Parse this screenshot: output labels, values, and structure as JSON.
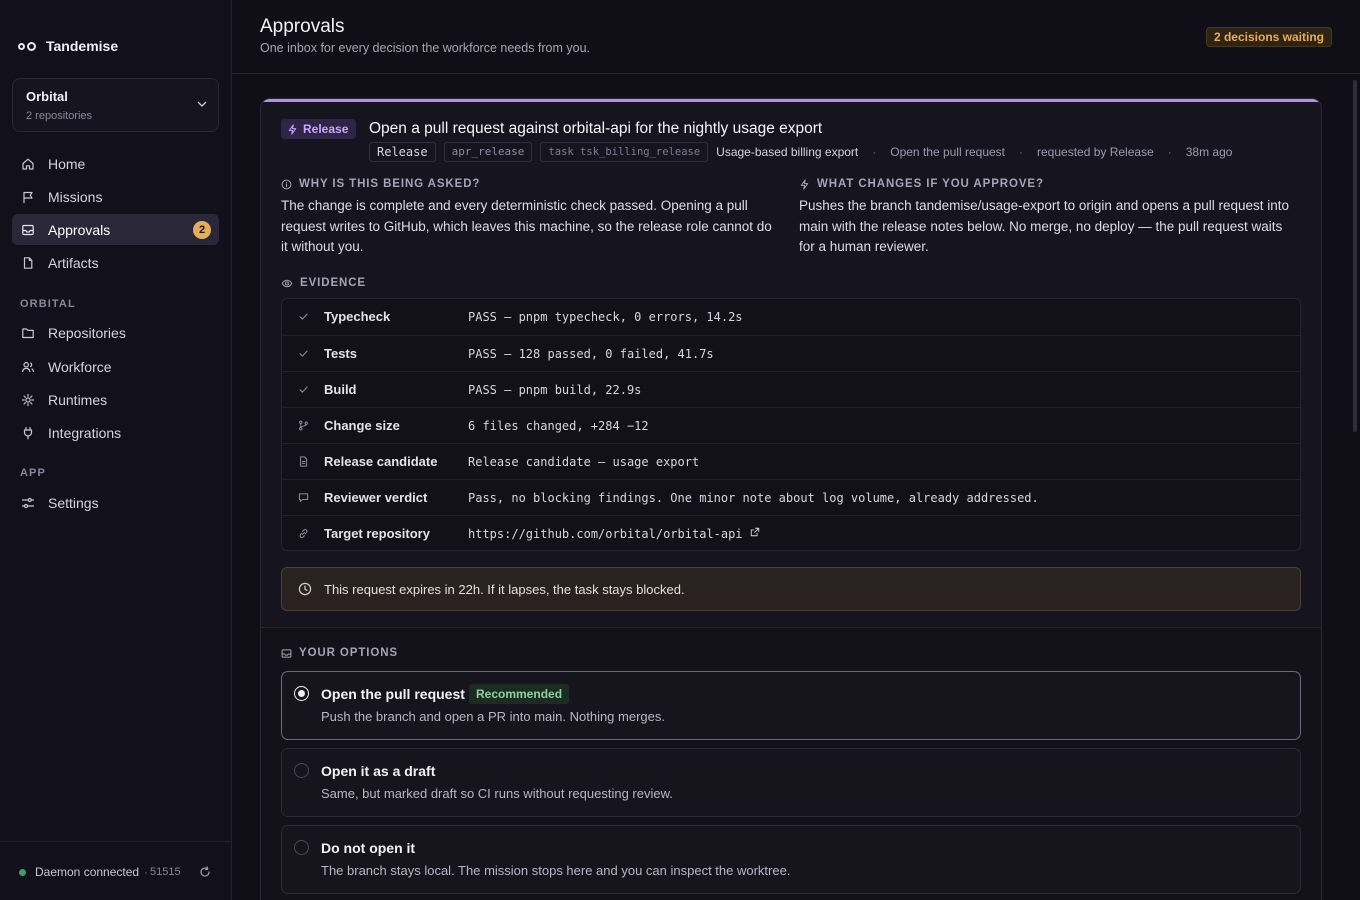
{
  "brand": {
    "name": "Tandemise"
  },
  "workspace": {
    "name": "Orbital",
    "subtitle": "2 repositories"
  },
  "nav": {
    "items": [
      {
        "label": "Home",
        "icon": "home-icon"
      },
      {
        "label": "Missions",
        "icon": "flag-icon"
      },
      {
        "label": "Approvals",
        "icon": "inbox-icon",
        "badge": "2",
        "active": true
      },
      {
        "label": "Artifacts",
        "icon": "file-icon"
      }
    ],
    "section_orbital": "ORBITAL",
    "orbital_items": [
      {
        "label": "Repositories",
        "icon": "folder-icon"
      },
      {
        "label": "Workforce",
        "icon": "users-icon"
      },
      {
        "label": "Runtimes",
        "icon": "cog-icon"
      },
      {
        "label": "Integrations",
        "icon": "plug-icon"
      }
    ],
    "section_app": "APP",
    "app_items": [
      {
        "label": "Settings",
        "icon": "sliders-icon"
      }
    ]
  },
  "status": {
    "text": "Daemon connected",
    "separator": "·",
    "port": "51515",
    "color": "#3fa067"
  },
  "header": {
    "title": "Approvals",
    "subtitle": "One inbox for every decision the workforce needs from you.",
    "badge": "2 decisions waiting"
  },
  "request": {
    "accent_color": "#b78cf0",
    "role_pill": "Release",
    "title": "Open a pull request against orbital-api for the nightly usage export",
    "meta": {
      "role_chip": "Release",
      "kind_chip": "apr_release",
      "task_chip": "task tsk_billing_release",
      "mission_link": "Usage-based billing export",
      "action": "Open the pull request",
      "requested_by": "requested by Release",
      "time": "38m ago",
      "dot": "·"
    },
    "why_heading": "WHY IS THIS BEING ASKED?",
    "why_text": "The change is complete and every deterministic check passed. Opening a pull request writes to GitHub, which leaves this machine, so the release role cannot do it without you.",
    "what_heading": "WHAT CHANGES IF YOU APPROVE?",
    "what_text": "Pushes the branch tandemise/usage-export to origin and opens a pull request into main with the release notes below. No merge, no deploy — the pull request waits for a human reviewer.",
    "evidence_heading": "EVIDENCE",
    "evidence": [
      {
        "icon": "check-icon",
        "label": "Typecheck",
        "value": "PASS — pnpm typecheck, 0 errors, 14.2s"
      },
      {
        "icon": "check-icon",
        "label": "Tests",
        "value": "PASS — 128 passed, 0 failed, 41.7s"
      },
      {
        "icon": "check-icon",
        "label": "Build",
        "value": "PASS — pnpm build, 22.9s"
      },
      {
        "icon": "branch-icon",
        "label": "Change size",
        "value": "6 files changed, +284 −12"
      },
      {
        "icon": "document-icon",
        "label": "Release candidate",
        "value": "Release candidate — usage export"
      },
      {
        "icon": "comment-icon",
        "label": "Reviewer verdict",
        "value": "Pass, no blocking findings. One minor note about log volume, already addressed."
      },
      {
        "icon": "link-icon",
        "label": "Target repository",
        "value": "https://github.com/orbital/orbital-api"
      }
    ],
    "expiry": "This request expires in 22h. If it lapses, the task stays blocked.",
    "options_heading": "YOUR OPTIONS",
    "options": [
      {
        "title": "Open the pull request",
        "badge": "Recommended",
        "description": "Push the branch and open a PR into main. Nothing merges.",
        "selected": true
      },
      {
        "title": "Open it as a draft",
        "description": "Same, but marked draft so CI runs without requesting review.",
        "selected": false
      },
      {
        "title": "Do not open it",
        "description": "The branch stays local. The mission stops here and you can inspect the worktree.",
        "selected": false
      }
    ]
  }
}
